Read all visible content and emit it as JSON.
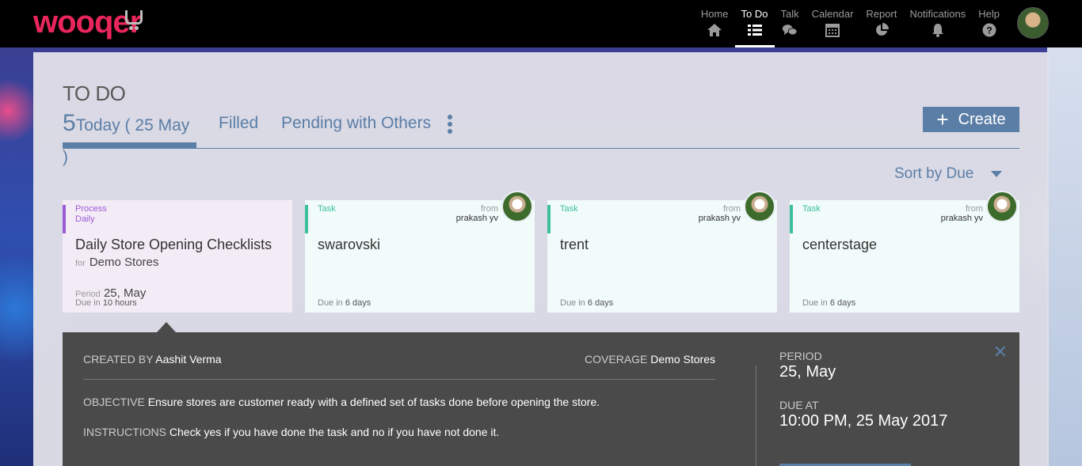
{
  "app": {
    "logo": "wooqer"
  },
  "nav": [
    {
      "label": "Home",
      "icon": "home-icon",
      "active": false
    },
    {
      "label": "To Do",
      "icon": "list-icon",
      "active": true
    },
    {
      "label": "Talk",
      "icon": "chat-icon",
      "active": false
    },
    {
      "label": "Calendar",
      "icon": "calendar-icon",
      "active": false
    },
    {
      "label": "Report",
      "icon": "pie-chart-icon",
      "active": false
    },
    {
      "label": "Notifications",
      "icon": "bell-icon",
      "active": false
    },
    {
      "label": "Help",
      "icon": "help-icon",
      "active": false
    }
  ],
  "page": {
    "title": "TO DO"
  },
  "tabs": {
    "today_count": "5",
    "today_label": "Today ( 25 May )",
    "filled": "Filled",
    "pending": "Pending with Others"
  },
  "toolbar": {
    "create_label": "Create",
    "sort_label": "Sort by Due"
  },
  "cards": [
    {
      "type_line1": "Process",
      "type_line2": "Daily",
      "name": "Daily Store Opening Checklists",
      "for_label": "for",
      "for_value": "Demo Stores",
      "period_label": "Period",
      "period_value": "25, May",
      "due_label": "Due in",
      "due_value": "10 hours"
    },
    {
      "type_line1": "Task",
      "from_label": "from",
      "from_value": "prakash  yv",
      "name": "swarovski",
      "due_label": "Due in",
      "due_value": "6 days"
    },
    {
      "type_line1": "Task",
      "from_label": "from",
      "from_value": "prakash  yv",
      "name": "trent",
      "due_label": "Due in",
      "due_value": "6 days"
    },
    {
      "type_line1": "Task",
      "from_label": "from",
      "from_value": "prakash  yv",
      "name": "centerstage",
      "due_label": "Due in",
      "due_value": "6 days"
    }
  ],
  "details": {
    "created_by_label": "CREATED BY",
    "created_by_value": "Aashit Verma",
    "coverage_label": "COVERAGE",
    "coverage_value": "Demo Stores",
    "objective_label": "OBJECTIVE",
    "objective_value": "Ensure stores are customer ready with a defined set of tasks done before opening the store.",
    "instructions_label": "INSTRUCTIONS",
    "instructions_value": "Check yes if you have done the task and no if you have not done it.",
    "period_label": "PERIOD",
    "period_value": "25, May",
    "due_at_label": "DUE AT",
    "due_at_value": "10:00 PM, 25 May 2017"
  },
  "colors": {
    "brand": "#e9265c",
    "accent": "#5b7ea6",
    "task": "#3bbf9e",
    "process": "#9b5bd6"
  }
}
